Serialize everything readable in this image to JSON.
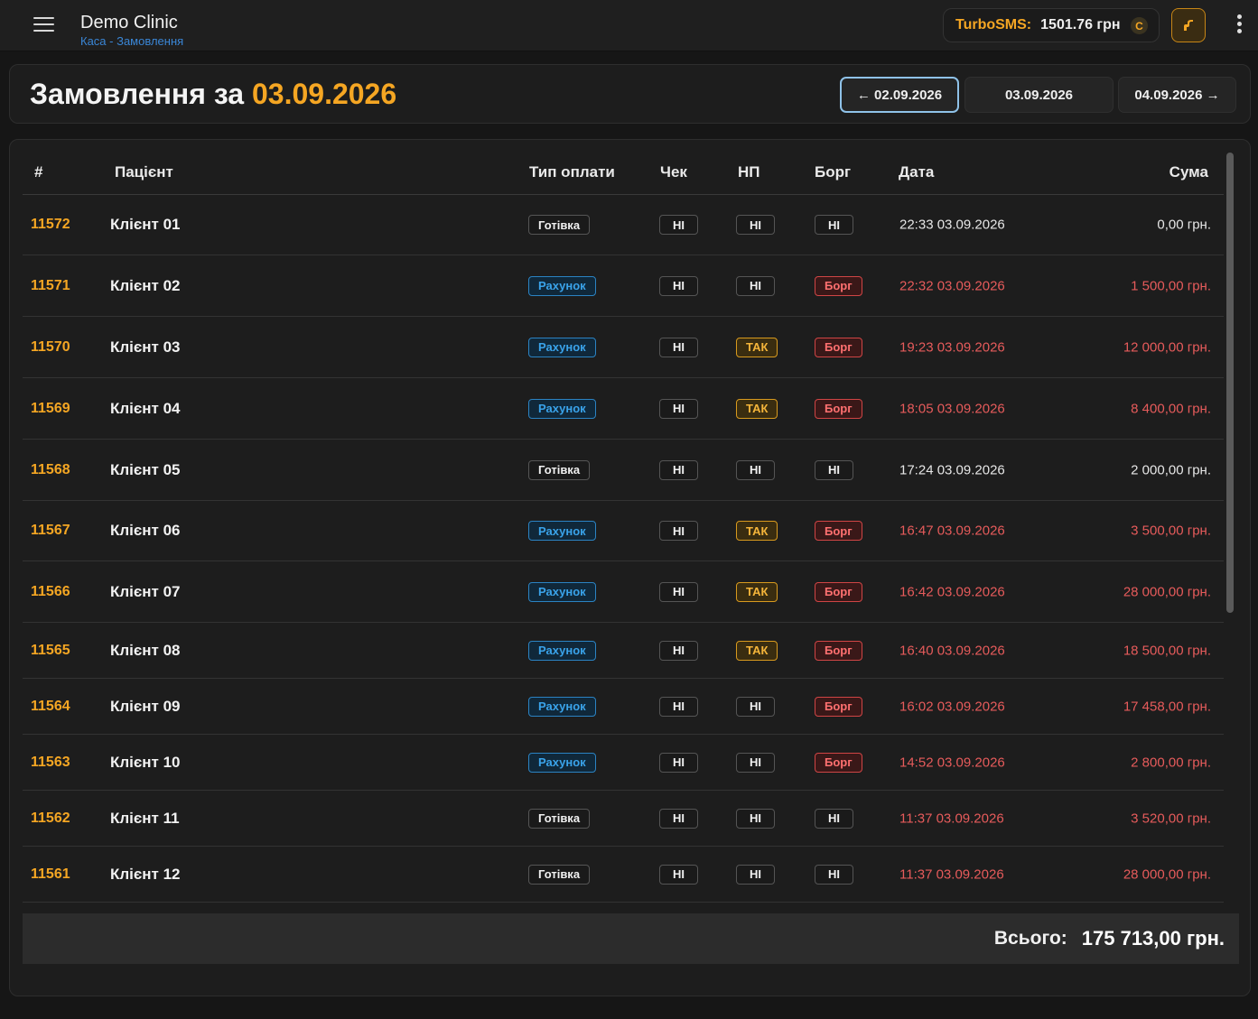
{
  "app": {
    "title": "Demo Clinic",
    "breadcrumb": "Каса - Замовлення"
  },
  "sms": {
    "label": "TurboSMS:",
    "balance": "1501.76 грн",
    "refresh_glyph": "C"
  },
  "icons": {
    "menu": "hamburger-icon",
    "tool": "wrench-icon",
    "more": "kebab-icon"
  },
  "colors": {
    "accent": "#f5a623",
    "info": "#3aa3ea",
    "danger": "#e65b5b",
    "background": "#161616"
  },
  "header": {
    "title_prefix": "Замовлення за",
    "title_date": "03.09.2026",
    "prev_label": "← 02.09.2026",
    "current_label": "03.09.2026",
    "next_label": "04.09.2026 →"
  },
  "table": {
    "columns": [
      "#",
      "Пацієнт",
      "Тип оплати",
      "Чек",
      "НП",
      "Борг",
      "Дата",
      "Сума"
    ],
    "rows": [
      {
        "id": "11572",
        "patient": "Клієнт 01",
        "payment": "Готівка",
        "payment_type": "neutral",
        "check": "НІ",
        "np": "НІ",
        "np_type": "neutral",
        "debt": "НІ",
        "debt_type": "neutral",
        "date": "22:33 03.09.2026",
        "sum": "0,00 грн.",
        "tone": "white"
      },
      {
        "id": "11571",
        "patient": "Клієнт 02",
        "payment": "Рахунок",
        "payment_type": "blue",
        "check": "НІ",
        "np": "НІ",
        "np_type": "neutral",
        "debt": "Борг",
        "debt_type": "red",
        "date": "22:32 03.09.2026",
        "sum": "1 500,00 грн.",
        "tone": "red"
      },
      {
        "id": "11570",
        "patient": "Клієнт 03",
        "payment": "Рахунок",
        "payment_type": "blue",
        "check": "НІ",
        "np": "ТАК",
        "np_type": "yellow",
        "debt": "Борг",
        "debt_type": "red",
        "date": "19:23 03.09.2026",
        "sum": "12 000,00 грн.",
        "tone": "red"
      },
      {
        "id": "11569",
        "patient": "Клієнт 04",
        "payment": "Рахунок",
        "payment_type": "blue",
        "check": "НІ",
        "np": "ТАК",
        "np_type": "yellow",
        "debt": "Борг",
        "debt_type": "red",
        "date": "18:05 03.09.2026",
        "sum": "8 400,00 грн.",
        "tone": "red"
      },
      {
        "id": "11568",
        "patient": "Клієнт 05",
        "payment": "Готівка",
        "payment_type": "neutral",
        "check": "НІ",
        "np": "НІ",
        "np_type": "neutral",
        "debt": "НІ",
        "debt_type": "neutral",
        "date": "17:24 03.09.2026",
        "sum": "2 000,00 грн.",
        "tone": "white"
      },
      {
        "id": "11567",
        "patient": "Клієнт 06",
        "payment": "Рахунок",
        "payment_type": "blue",
        "check": "НІ",
        "np": "ТАК",
        "np_type": "yellow",
        "debt": "Борг",
        "debt_type": "red",
        "date": "16:47 03.09.2026",
        "sum": "3 500,00 грн.",
        "tone": "red"
      },
      {
        "id": "11566",
        "patient": "Клієнт 07",
        "payment": "Рахунок",
        "payment_type": "blue",
        "check": "НІ",
        "np": "ТАК",
        "np_type": "yellow",
        "debt": "Борг",
        "debt_type": "red",
        "date": "16:42 03.09.2026",
        "sum": "28 000,00 грн.",
        "tone": "red"
      },
      {
        "id": "11565",
        "patient": "Клієнт 08",
        "payment": "Рахунок",
        "payment_type": "blue",
        "check": "НІ",
        "np": "ТАК",
        "np_type": "yellow",
        "debt": "Борг",
        "debt_type": "red",
        "date": "16:40 03.09.2026",
        "sum": "18 500,00 грн.",
        "tone": "red"
      },
      {
        "id": "11564",
        "patient": "Клієнт 09",
        "payment": "Рахунок",
        "payment_type": "blue",
        "check": "НІ",
        "np": "НІ",
        "np_type": "neutral",
        "debt": "Борг",
        "debt_type": "red",
        "date": "16:02 03.09.2026",
        "sum": "17 458,00 грн.",
        "tone": "red"
      },
      {
        "id": "11563",
        "patient": "Клієнт 10",
        "payment": "Рахунок",
        "payment_type": "blue",
        "check": "НІ",
        "np": "НІ",
        "np_type": "neutral",
        "debt": "Борг",
        "debt_type": "red",
        "date": "14:52 03.09.2026",
        "sum": "2 800,00 грн.",
        "tone": "red"
      },
      {
        "id": "11562",
        "patient": "Клієнт 11",
        "payment": "Готівка",
        "payment_type": "neutral",
        "check": "НІ",
        "np": "НІ",
        "np_type": "neutral",
        "debt": "НІ",
        "debt_type": "neutral",
        "date": "11:37 03.09.2026",
        "sum": "3 520,00 грн.",
        "tone": "red"
      },
      {
        "id": "11561",
        "patient": "Клієнт 12",
        "payment": "Готівка",
        "payment_type": "neutral",
        "check": "НІ",
        "np": "НІ",
        "np_type": "neutral",
        "debt": "НІ",
        "debt_type": "neutral",
        "date": "11:37 03.09.2026",
        "sum": "28 000,00 грн.",
        "tone": "red"
      }
    ]
  },
  "total": {
    "label": "Всього:",
    "value": "175 713,00 грн."
  }
}
